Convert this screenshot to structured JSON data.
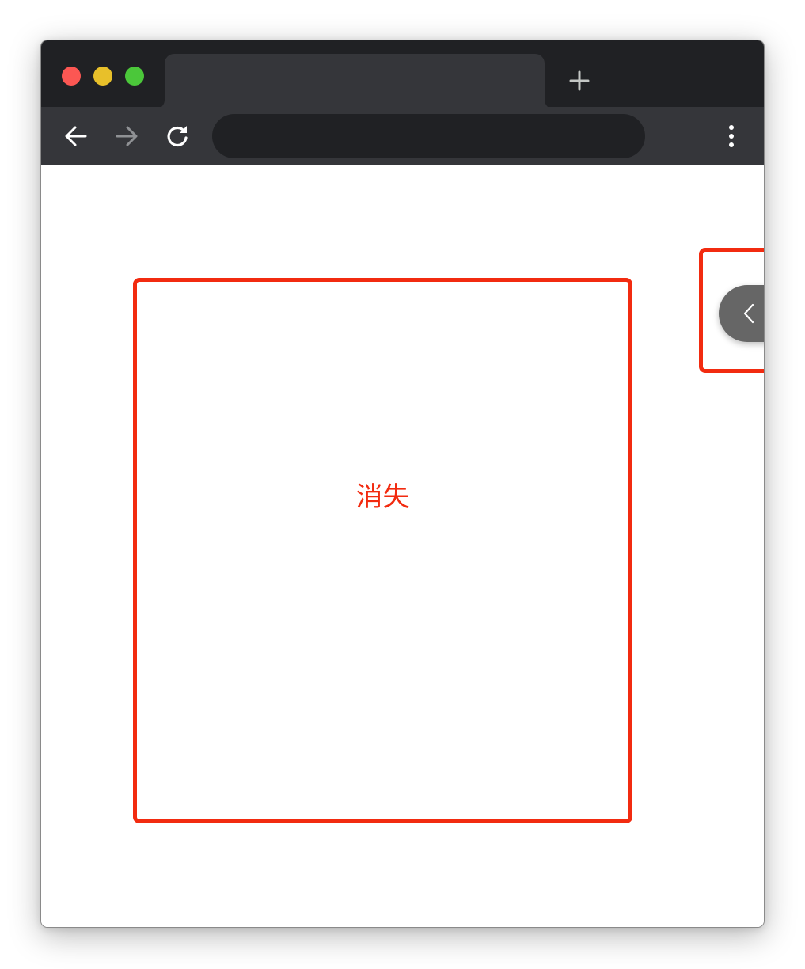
{
  "browser": {
    "traffic_lights": {
      "close_color": "#fc5753",
      "minimize_color": "#e8c02a",
      "maximize_color": "#4bc73a"
    },
    "tab": {
      "title": ""
    },
    "new_tab_icon": "plus-icon",
    "toolbar": {
      "back_icon": "arrow-left-icon",
      "forward_icon": "arrow-right-icon",
      "reload_icon": "reload-icon",
      "address": "",
      "menu_icon": "vertical-dots-icon"
    }
  },
  "page": {
    "main_panel": {
      "label": "消失",
      "highlight_color": "#f22b10"
    },
    "side_panel": {
      "toggle_icon": "chevron-left-icon",
      "highlight_color": "#f22b10"
    }
  }
}
